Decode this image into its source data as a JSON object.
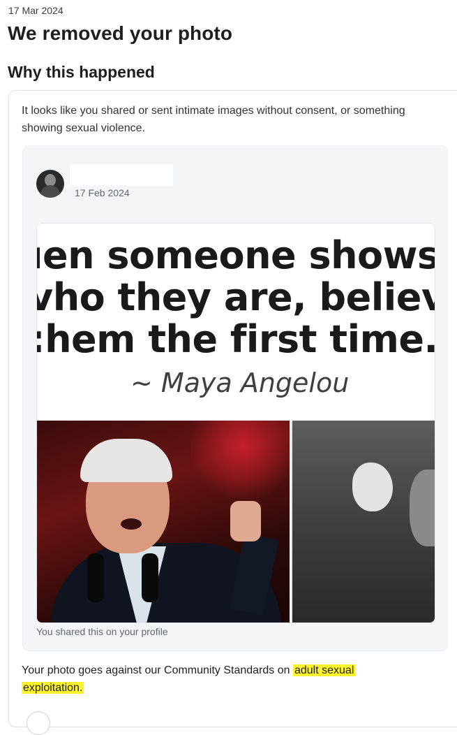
{
  "notice": {
    "date": "17 Mar 2024",
    "title": "We removed your photo",
    "section_heading": "Why this happened",
    "reason": "It looks like you shared or sent intimate images without consent, or something showing sexual violence."
  },
  "post": {
    "date": "17 Feb 2024",
    "image": {
      "quote_lines": [
        "ıen someone shows",
        "vho they are, believ",
        ":hem the first time."
      ],
      "quote_author": "~ Maya Angelou"
    },
    "caption": "You shared this on your profile"
  },
  "policy": {
    "prefix": "Your photo goes against our Community Standards on ",
    "highlight_1": "adult sexual",
    "highlight_2": "exploitation.",
    "highlight_color": "#fff32a"
  }
}
